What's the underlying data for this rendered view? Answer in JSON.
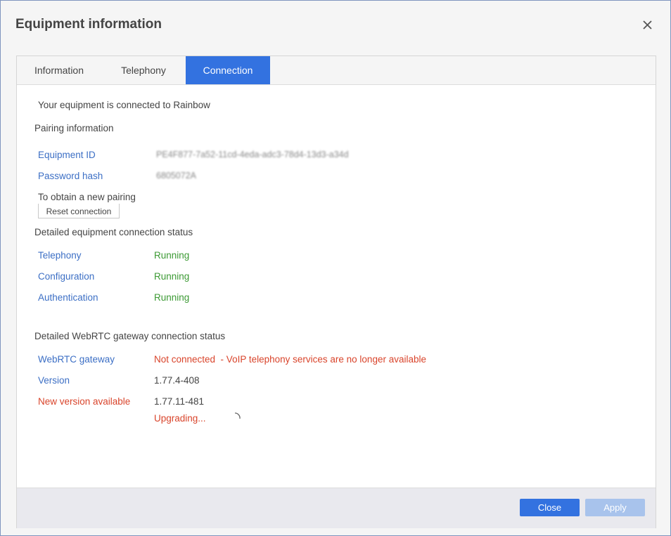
{
  "dialog": {
    "title": "Equipment information"
  },
  "tabs": [
    {
      "label": "Information"
    },
    {
      "label": "Telephony"
    },
    {
      "label": "Connection"
    }
  ],
  "connection": {
    "status_text": "Your equipment is connected to Rainbow",
    "pairing": {
      "heading": "Pairing information",
      "equipment_id_label": "Equipment ID",
      "equipment_id_value": "PE4F877-7a52-11cd-4eda-adc3-78d4-13d3-a34d",
      "password_hash_label": "Password hash",
      "password_hash_value": "6805072A",
      "new_pairing_text": "To obtain a new pairing",
      "reset_button": "Reset connection"
    },
    "equipment_status": {
      "heading": "Detailed equipment connection status",
      "rows": [
        {
          "label": "Telephony",
          "value": "Running"
        },
        {
          "label": "Configuration",
          "value": "Running"
        },
        {
          "label": "Authentication",
          "value": "Running"
        }
      ]
    },
    "webrtc": {
      "heading": "Detailed WebRTC gateway connection status",
      "gateway_label": "WebRTC gateway",
      "gateway_value": "Not connected  - VoIP telephony services are no longer available",
      "version_label": "Version",
      "version_value": "1.77.4-408",
      "new_version_label": "New version available",
      "new_version_value": "1.77.11-481",
      "upgrade_status": "Upgrading..."
    }
  },
  "footer": {
    "close_label": "Close",
    "apply_label": "Apply"
  },
  "colors": {
    "accent": "#3372e0",
    "link": "#3c6fc5",
    "ok": "#3c9a34",
    "error": "#d9442b"
  }
}
